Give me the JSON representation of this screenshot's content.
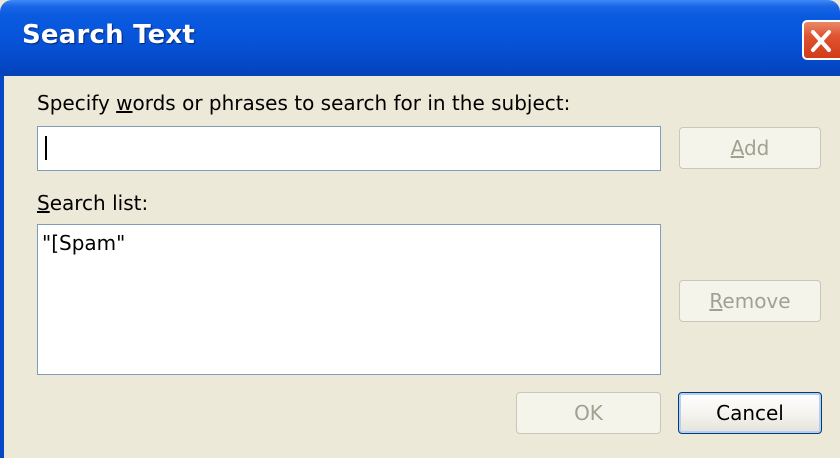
{
  "dialog": {
    "title": "Search Text",
    "close_icon": "close-icon"
  },
  "prompt": {
    "pre": "Specify ",
    "accel": "w",
    "post": "ords or phrases to search for in the subject:"
  },
  "search_input": {
    "value": "",
    "placeholder": ""
  },
  "add_button": {
    "accel": "A",
    "rest": "dd",
    "enabled": false
  },
  "search_list_label": {
    "accel": "S",
    "rest": "earch list:"
  },
  "search_list": {
    "items": [
      "\"[Spam\""
    ]
  },
  "remove_button": {
    "accel": "R",
    "rest": "emove",
    "enabled": false
  },
  "ok_button": {
    "label": "OK",
    "enabled": false
  },
  "cancel_button": {
    "label": "Cancel",
    "enabled": true
  }
}
